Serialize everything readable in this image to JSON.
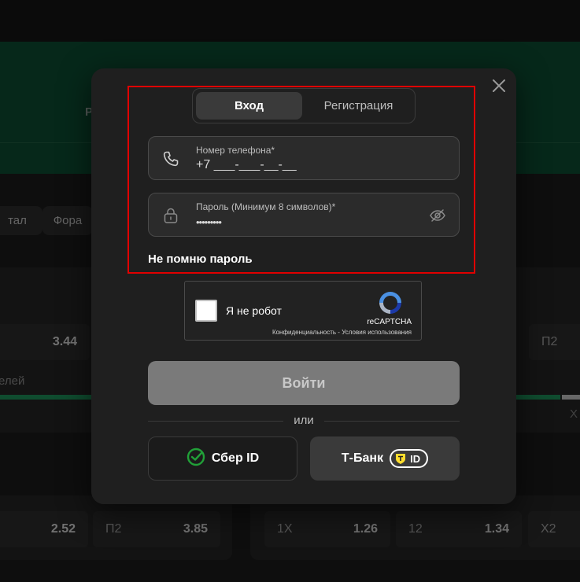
{
  "background": {
    "green_letter": "Р",
    "chips": [
      "тал",
      "Фора"
    ],
    "row1": {
      "value": "3.44",
      "right_label": "П2"
    },
    "text_left": "елей",
    "text_right": "Х",
    "bottom_left": [
      {
        "label": "",
        "value": "2.52"
      },
      {
        "label": "П2",
        "value": "3.85"
      }
    ],
    "bottom_right": [
      {
        "label": "1Х",
        "value": "1.26"
      },
      {
        "label": "12",
        "value": "1.34"
      },
      {
        "label": "Х2",
        "value": ""
      }
    ]
  },
  "modal": {
    "tabs": [
      "Вход",
      "Регистрация"
    ],
    "phone": {
      "label": "Номер телефона*",
      "value": "+7 ___-___-__-__"
    },
    "password": {
      "label": "Пароль (Минимум 8 символов)*",
      "value": "•••••••••"
    },
    "forgot": "Не помню пароль",
    "captcha": {
      "label": "Я не робот",
      "brand": "reCAPTCHA",
      "links": "Конфиденциальность - Условия использования"
    },
    "login_button": "Войти",
    "or_text": "или",
    "sber_button": "Сбер ID",
    "tbank_button": "Т-Банк",
    "tbank_badge": "ID"
  },
  "colors": {
    "accent_green": "#0c4a30",
    "highlight": "#e00000",
    "sber_green": "#21a038",
    "tbank_yellow": "#ffdd2d"
  },
  "icons": [
    "phone-icon",
    "lock-icon",
    "eye-off-icon",
    "close-icon",
    "recaptcha-icon",
    "sber-icon",
    "tbank-shield-icon"
  ]
}
